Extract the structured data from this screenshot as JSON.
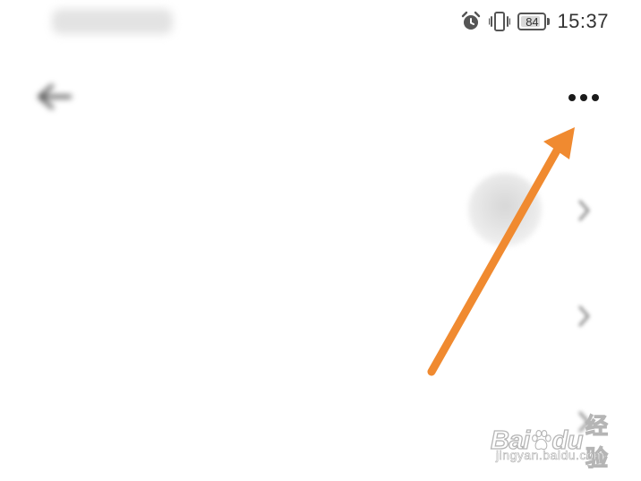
{
  "status_bar": {
    "carrier": "",
    "battery": 84,
    "time": "15:37",
    "icons": [
      "alarm-icon",
      "vibrate-icon"
    ]
  },
  "header": {
    "title": "",
    "back_icon": "back-arrow-icon",
    "more_icon": "more-dots-icon"
  },
  "rows": [
    {
      "label": "",
      "value": "",
      "type": "avatar"
    },
    {
      "label": "",
      "value": "",
      "type": "text"
    },
    {
      "label": "",
      "value": "",
      "type": "text"
    }
  ],
  "overlay": {
    "arrow_color": "#f08a30"
  },
  "watermark": {
    "bai": "Bai",
    "du": "du",
    "jingyan": "经验",
    "url": "jingyan.baidu.com"
  }
}
